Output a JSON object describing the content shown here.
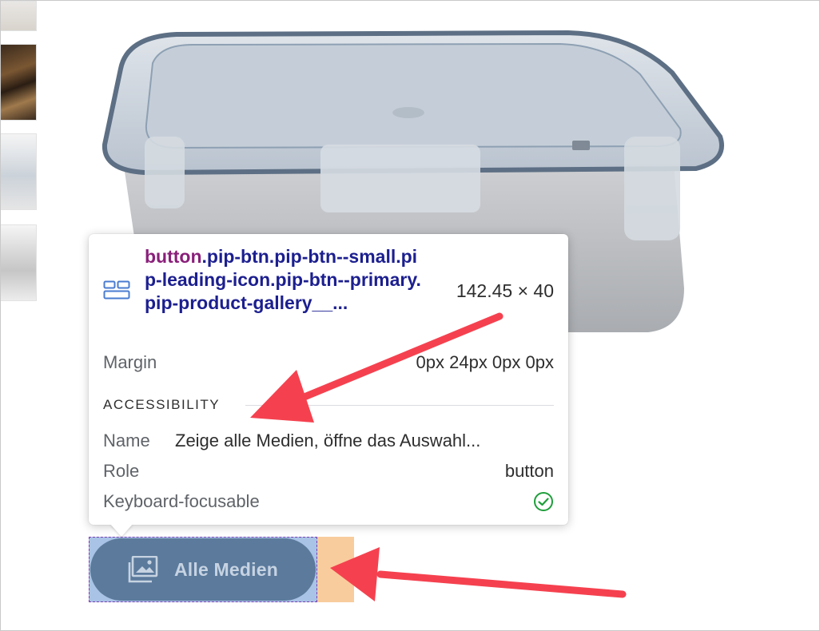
{
  "tooltip": {
    "selector_tag": "button",
    "selector_rest": ".pip-btn.pip-btn--small.pip-leading-icon.pip-btn--primary.pip-product-gallery__...",
    "dimensions": "142.45 × 40",
    "margin_label": "Margin",
    "margin_value": "0px 24px 0px 0px",
    "accessibility_heading": "ACCESSIBILITY",
    "name_label": "Name",
    "name_value": "Zeige alle Medien, öffne das Auswahl...",
    "role_label": "Role",
    "role_value": "button",
    "keyboard_label": "Keyboard-focusable",
    "keyboard_focusable": true
  },
  "button": {
    "label": "Alle Medien",
    "icon": "image-gallery-icon"
  },
  "colors": {
    "arrow": "#f5414f",
    "button_bg": "#5b7a9c",
    "selector_tag": "#8a1f7a",
    "selector_class": "#1c1f8f",
    "margin_highlight": "#f9cc9d",
    "content_highlight": "#a9c3e6"
  }
}
